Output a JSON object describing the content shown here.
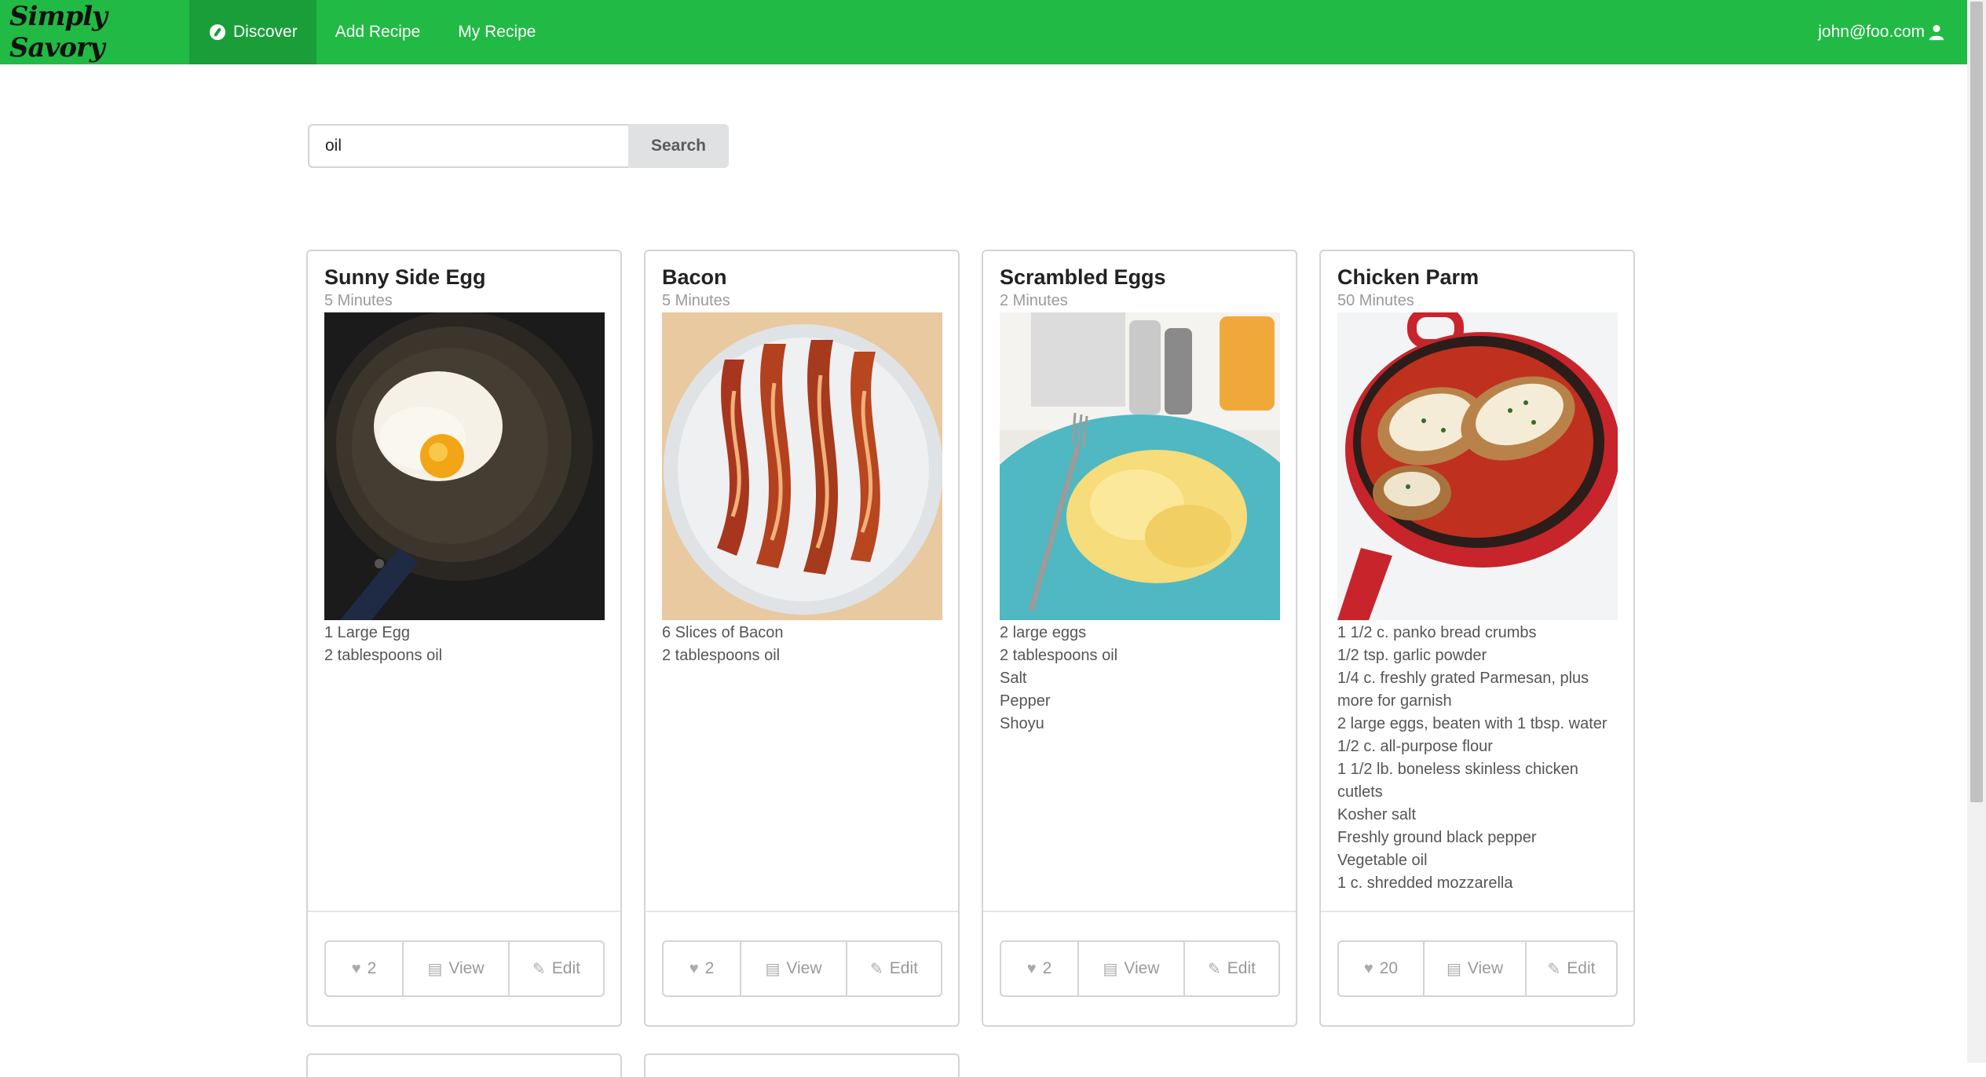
{
  "brand": "Simply Savory",
  "nav": {
    "discover": "Discover",
    "add_recipe": "Add Recipe",
    "my_recipe": "My Recipe",
    "user_email": "john@foo.com"
  },
  "search": {
    "value": "oil",
    "button": "Search"
  },
  "cards": [
    {
      "title": "Sunny Side Egg",
      "time": "5 Minutes",
      "image": "fried-egg-in-pan",
      "ingredients": [
        "1 Large Egg",
        "2 tablespoons oil"
      ],
      "likes": "2",
      "view": "View",
      "edit": "Edit"
    },
    {
      "title": "Bacon",
      "time": "5 Minutes",
      "image": "bacon-on-plate",
      "ingredients": [
        "6 Slices of Bacon",
        "2 tablespoons oil"
      ],
      "likes": "2",
      "view": "View",
      "edit": "Edit"
    },
    {
      "title": "Scrambled Eggs",
      "time": "2 Minutes",
      "image": "scrambled-eggs-plate",
      "ingredients": [
        "2 large eggs",
        "2 tablespoons oil",
        "Salt",
        "Pepper",
        "Shoyu"
      ],
      "likes": "2",
      "view": "View",
      "edit": "Edit"
    },
    {
      "title": "Chicken Parm",
      "time": "50 Minutes",
      "image": "chicken-parm-skillet",
      "ingredients": [
        "1 1/2 c. panko bread crumbs",
        "1/2 tsp. garlic powder",
        "1/4 c. freshly grated Parmesan, plus more for garnish",
        "2 large eggs, beaten with 1 tbsp. water",
        "1/2 c. all-purpose flour",
        "1 1/2 lb. boneless skinless chicken cutlets",
        "Kosher salt",
        "Freshly ground black pepper",
        "Vegetable oil",
        "1 c. shredded mozzarella"
      ],
      "likes": "20",
      "view": "View",
      "edit": "Edit"
    }
  ],
  "colors": {
    "navbar": "#21ba45",
    "active_nav": "#1a9e3a"
  }
}
